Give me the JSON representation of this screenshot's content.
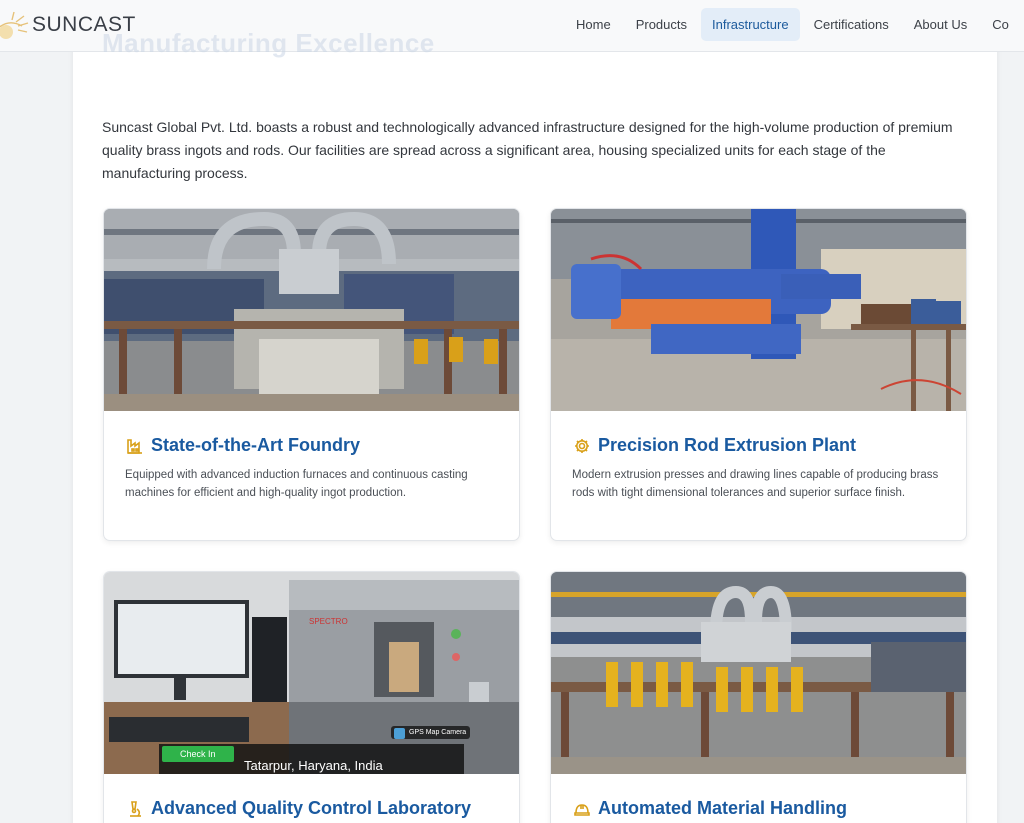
{
  "brand": {
    "name": "SUNCAST"
  },
  "nav": {
    "items": [
      "Home",
      "Products",
      "Infrastructure",
      "Certifications",
      "About Us",
      "Co"
    ],
    "active_index": 2
  },
  "page": {
    "faded_title": "Manufacturing Excellence",
    "intro": "Suncast Global Pvt. Ltd. boasts a robust and technologically advanced infrastructure designed for the high-volume production of premium quality brass ingots and rods. Our facilities are spread across a significant area, housing specialized units for each stage of the manufacturing process."
  },
  "cards": [
    {
      "icon": "factory-icon",
      "title": "State-of-the-Art Foundry",
      "description": "Equipped with advanced induction furnaces and continuous casting machines for efficient and high-quality ingot production."
    },
    {
      "icon": "gear-icon",
      "title": "Precision Rod Extrusion Plant",
      "description": "Modern extrusion presses and drawing lines capable of producing brass rods with tight dimensional tolerances and superior surface finish."
    },
    {
      "icon": "microscope-icon",
      "title": "Advanced Quality Control Laboratory",
      "description": "",
      "photo_overlay": {
        "check_in": "Check In",
        "location": "Tatarpur, Haryana, India",
        "camera_badge": "GPS Map Camera"
      }
    },
    {
      "icon": "hard-hat-icon",
      "title": "Automated Material Handling",
      "description": ""
    }
  ],
  "colors": {
    "accent": "#1a5aa0",
    "icon": "#d9a019",
    "nav_active_bg": "#e3edf8"
  }
}
